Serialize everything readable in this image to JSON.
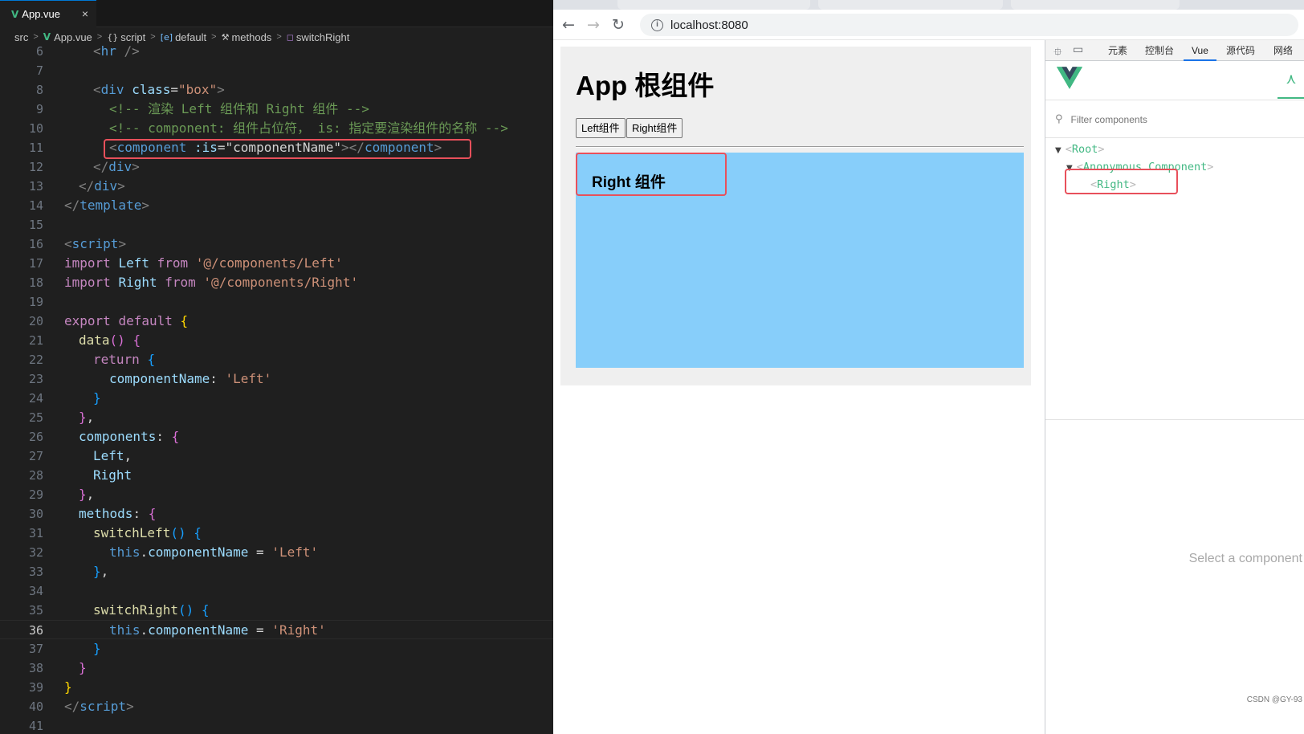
{
  "editor": {
    "tab_label": "App.vue",
    "tab_close": "×",
    "breadcrumb": {
      "src": "src",
      "file": "App.vue",
      "script": "script",
      "default": "default",
      "methods": "methods",
      "switchRight": "switchRight"
    },
    "current_line": "36",
    "line_numbers": [
      "6",
      "7",
      "8",
      "9",
      "10",
      "11",
      "12",
      "13",
      "14",
      "15",
      "16",
      "17",
      "18",
      "19",
      "20",
      "21",
      "22",
      "23",
      "24",
      "25",
      "26",
      "27",
      "28",
      "29",
      "30",
      "31",
      "32",
      "33",
      "34",
      "35",
      "36",
      "37",
      "38",
      "39",
      "40",
      "41"
    ],
    "code": {
      "l8_div": "div",
      "l8_class": "class",
      "l8_box": "\"box\"",
      "l9_comment": "<!-- 渲染 Left 组件和 Right 组件 -->",
      "l10_comment": "<!-- component: 组件占位符， is: 指定要渲染组件的名称 -->",
      "l11_component": "component",
      "l11_is": ":is",
      "l11_value": "\"componentName\"",
      "l16_script": "script",
      "l17_import": "import",
      "l17_left": "Left",
      "l17_from": "from",
      "l17_path": "'@/components/Left'",
      "l18_import": "import",
      "l18_right": "Right",
      "l18_from": "from",
      "l18_path": "'@/components/Right'",
      "l20_export": "export",
      "l20_default": "default",
      "l21_data": "data",
      "l22_return": "return",
      "l23_key": "componentName",
      "l23_val": "'Left'",
      "l26_components": "components",
      "l27_left": "Left",
      "l28_right": "Right",
      "l30_methods": "methods",
      "l31_fn": "switchLeft",
      "l32_this": "this",
      "l32_prop": "componentName",
      "l32_val": "'Left'",
      "l35_fn": "switchRight",
      "l36_this": "this",
      "l36_prop": "componentName",
      "l36_val": "'Right'",
      "l40_script": "script"
    }
  },
  "browser": {
    "address": "localhost:8080",
    "page": {
      "title": "App 根组件",
      "left_button": "Left组件",
      "right_button": "Right组件",
      "right_component_title": "Right 组件"
    }
  },
  "devtools": {
    "tabs": [
      "元素",
      "控制台",
      "Vue",
      "源代码",
      "网络"
    ],
    "active_tab": "Vue",
    "filter_placeholder": "Filter components",
    "tree": {
      "root": "Root",
      "anonymous": "Anonymous Component",
      "right": "Right"
    },
    "select_component": "Select a component",
    "credit": "CSDN @GY-93"
  },
  "colors": {
    "editor_bg": "#1f1f1f",
    "highlight_red": "#e8505b",
    "blue_box": "#87cefa",
    "vue_green": "#42b883"
  }
}
